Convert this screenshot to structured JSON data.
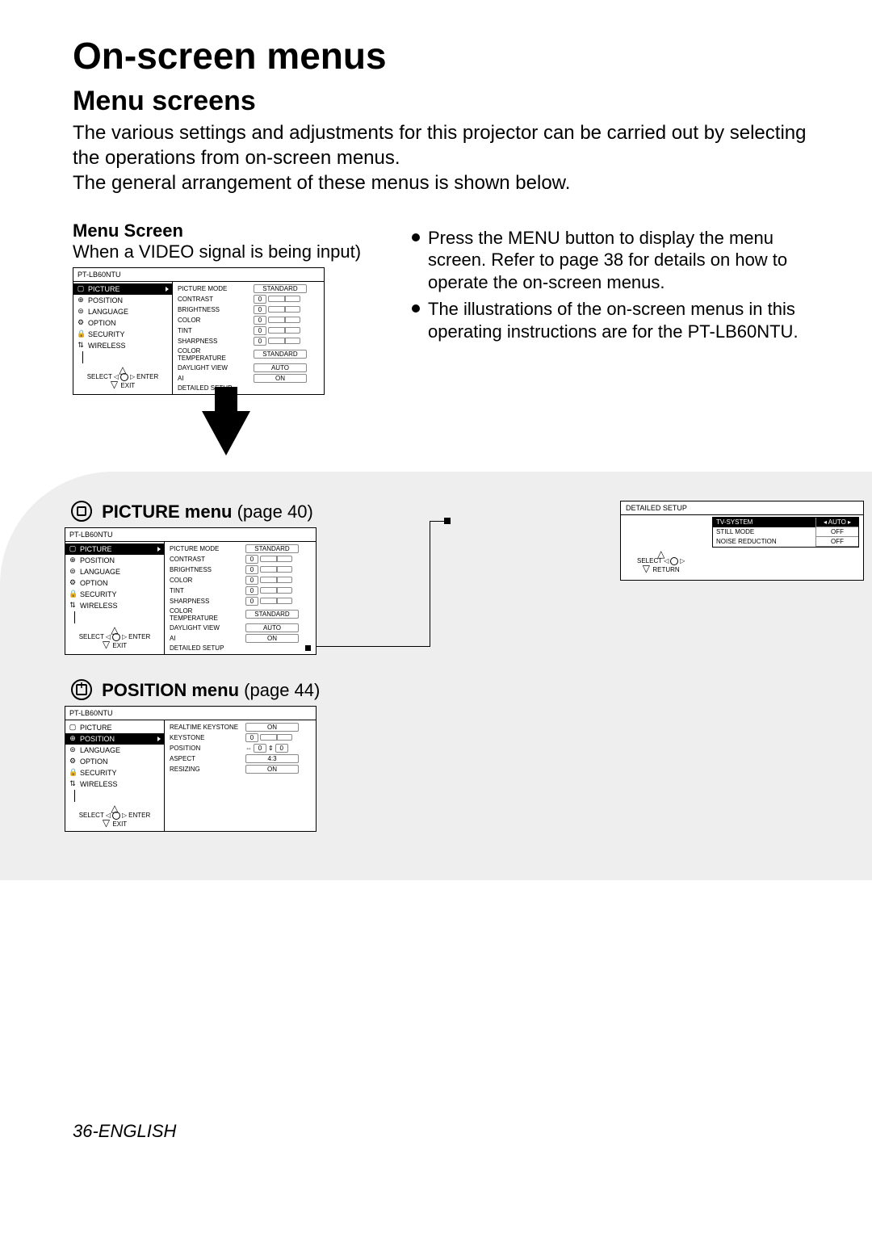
{
  "title": "On-screen menus",
  "subtitle": "Menu screens",
  "intro1": "The various settings and adjustments for this projector can be carried out by selecting the operations from on-screen menus.",
  "intro2": "The general arrangement of these menus is shown below.",
  "menuScreen": {
    "heading": "Menu Screen",
    "note": "When a VIDEO signal is being input)"
  },
  "bullets": [
    "Press the MENU button to display the menu screen. Refer to page 38 for details on how to operate the on-screen menus.",
    "The illustrations of the on-screen menus in this operating instructions are for the PT-LB60NTU."
  ],
  "osd": {
    "model": "PT-LB60NTU",
    "nav": [
      "PICTURE",
      "POSITION",
      "LANGUAGE",
      "OPTION",
      "SECURITY",
      "WIRELESS"
    ],
    "selectLabel": "SELECT",
    "enterLabel": "ENTER",
    "exitLabel": "EXIT",
    "returnLabel": "RETURN"
  },
  "picture_rows": [
    {
      "label": "PICTURE MODE",
      "type": "val",
      "value": "STANDARD"
    },
    {
      "label": "CONTRAST",
      "type": "slider",
      "value": "0"
    },
    {
      "label": "BRIGHTNESS",
      "type": "slider",
      "value": "0"
    },
    {
      "label": "COLOR",
      "type": "slider",
      "value": "0"
    },
    {
      "label": "TINT",
      "type": "slider",
      "value": "0"
    },
    {
      "label": "SHARPNESS",
      "type": "slider",
      "value": "0"
    },
    {
      "label": "COLOR TEMPERATURE",
      "type": "val",
      "value": "STANDARD"
    },
    {
      "label": "DAYLIGHT VIEW",
      "type": "val",
      "value": "AUTO"
    },
    {
      "label": "AI",
      "type": "val",
      "value": "ON"
    },
    {
      "label": "DETAILED SETUP",
      "type": "link",
      "value": ""
    }
  ],
  "position_rows": [
    {
      "label": "REALTIME KEYSTONE",
      "type": "val",
      "value": "ON"
    },
    {
      "label": "KEYSTONE",
      "type": "slider",
      "value": "0"
    },
    {
      "label": "POSITION",
      "type": "dual",
      "v1": "0",
      "v2": "0"
    },
    {
      "label": "ASPECT",
      "type": "val",
      "value": "4:3"
    },
    {
      "label": "RESIZING",
      "type": "val",
      "value": "ON"
    }
  ],
  "detailed": {
    "heading": "DETAILED SETUP",
    "rows": [
      {
        "label": "TV-SYSTEM",
        "value": "AUTO",
        "sel": true
      },
      {
        "label": "STILL MODE",
        "value": "OFF"
      },
      {
        "label": "NOISE REDUCTION",
        "value": "OFF"
      }
    ]
  },
  "sections": {
    "picture": {
      "title": "PICTURE menu",
      "page": "(page 40)"
    },
    "position": {
      "title": "POSITION menu",
      "page": "(page 44)"
    }
  },
  "footer": "36-ENGLISH"
}
